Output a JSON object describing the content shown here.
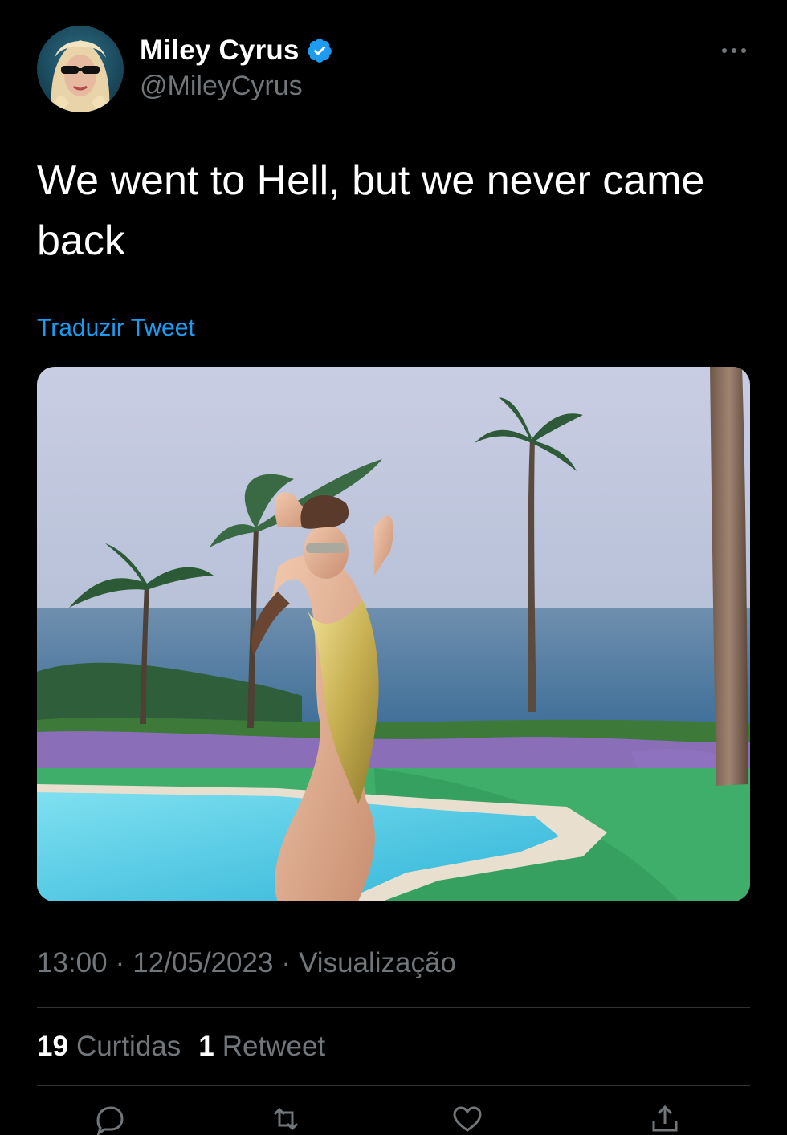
{
  "author": {
    "name": "Miley Cyrus",
    "handle": "@MileyCyrus",
    "verified": true,
    "avatar_icon": "profile-photo"
  },
  "tweet": {
    "text": "We went to Hell, but we never came back",
    "translate_label": "Traduzir Tweet",
    "media_icon": "photo"
  },
  "meta": {
    "time": "13:00",
    "separator": "·",
    "date": "12/05/2023",
    "views_label": "Visualização"
  },
  "stats": {
    "likes_count": "19",
    "likes_label": "Curtidas",
    "retweets_count": "1",
    "retweets_label": "Retweet"
  },
  "actions": [
    "reply-icon",
    "retweet-icon",
    "like-icon",
    "share-icon"
  ],
  "colors": {
    "background": "#000000",
    "primary_text": "#ffffff",
    "secondary_text": "#71767b",
    "link": "#1d9bf0",
    "divider": "#2f3336",
    "verified_badge": "#1d9bf0"
  }
}
